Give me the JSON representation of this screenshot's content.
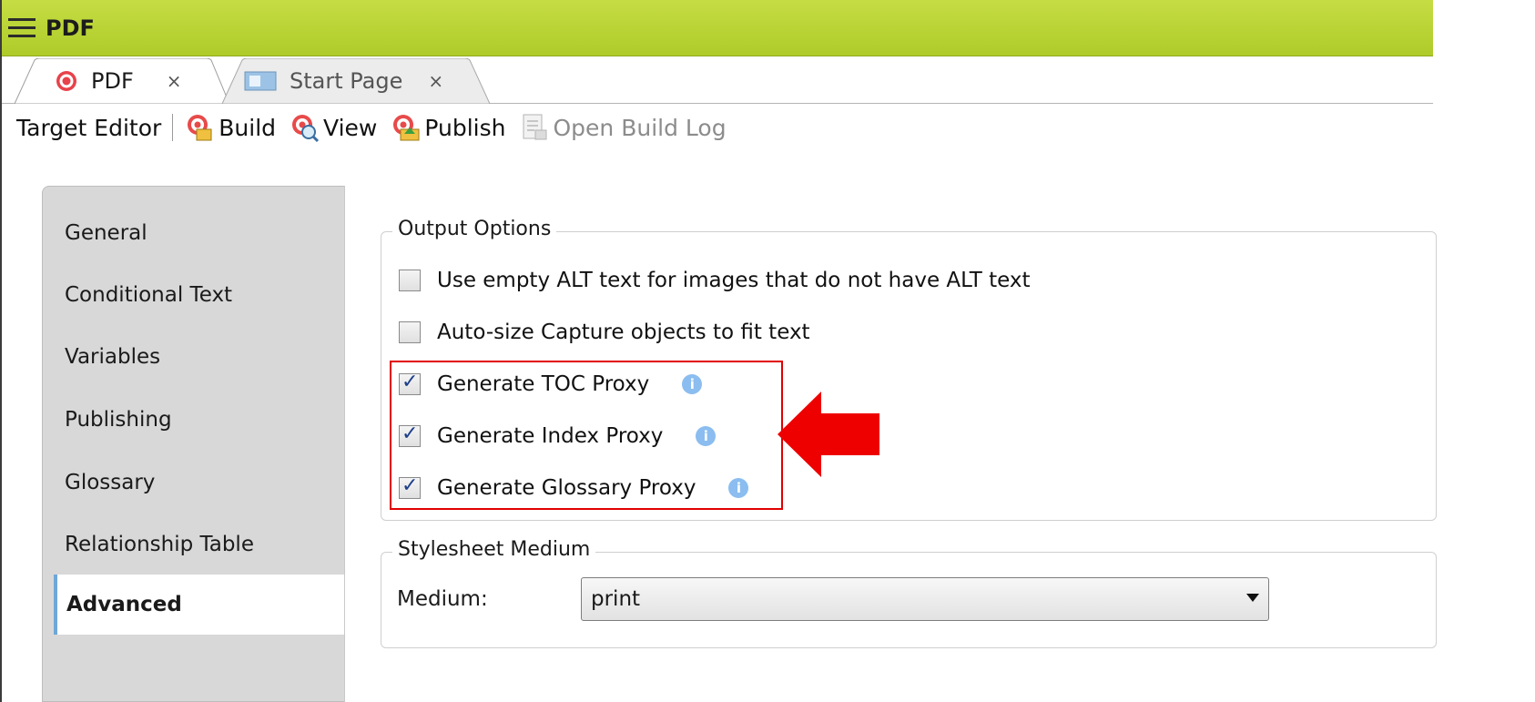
{
  "window": {
    "title": "PDF"
  },
  "tabs": [
    {
      "label": "PDF",
      "close": "×",
      "active": true
    },
    {
      "label": "Start Page",
      "close": "×",
      "active": false
    }
  ],
  "toolbar": {
    "label": "Target Editor",
    "buttons": [
      {
        "label": "Build",
        "icon": "build-icon"
      },
      {
        "label": "View",
        "icon": "view-icon"
      },
      {
        "label": "Publish",
        "icon": "publish-icon"
      },
      {
        "label": "Open Build Log",
        "icon": "build-log-icon",
        "disabled": true
      }
    ]
  },
  "sidebar": {
    "items": [
      "General",
      "Conditional Text",
      "Variables",
      "Publishing",
      "Glossary",
      "Relationship Table",
      "Advanced"
    ],
    "selected": "Advanced"
  },
  "output_options": {
    "legend": "Output Options",
    "options": [
      {
        "label": "Use empty ALT text for images that do not have ALT text",
        "checked": false
      },
      {
        "label": "Auto-size Capture objects to fit text",
        "checked": false
      },
      {
        "label": "Generate TOC Proxy",
        "checked": true
      },
      {
        "label": "Generate Index Proxy",
        "checked": true
      },
      {
        "label": "Generate Glossary Proxy",
        "checked": true
      }
    ]
  },
  "stylesheet_medium": {
    "legend": "Stylesheet Medium",
    "label": "Medium:",
    "value": "print"
  },
  "colors": {
    "titlebar": "#b5d033",
    "highlight": "#e00000",
    "info": "#8bbdf0"
  }
}
